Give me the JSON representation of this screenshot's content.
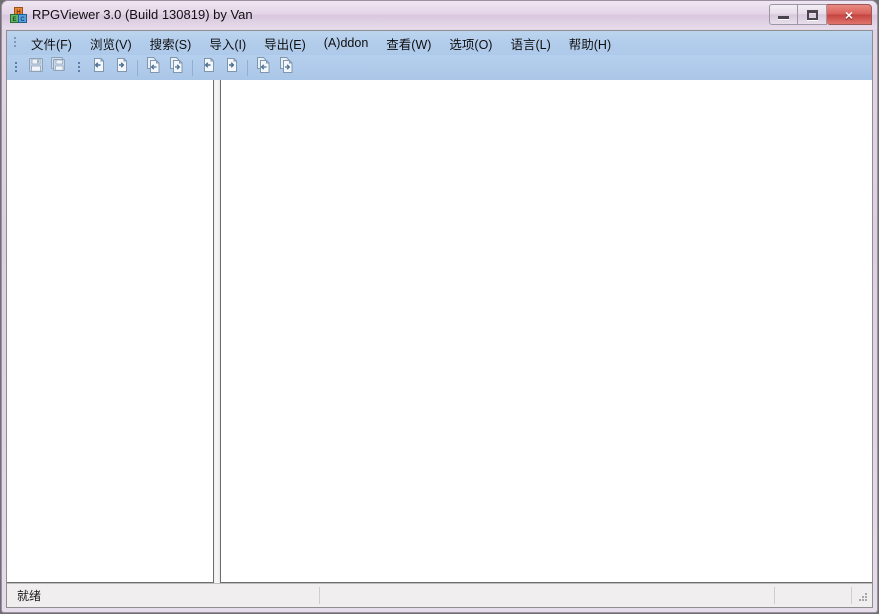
{
  "window": {
    "title": "RPGViewer 3.0 (Build 130819) by Van",
    "app_icon": "blocks-icon",
    "controls": {
      "minimize_label": "",
      "maximize_label": "",
      "close_label": "×"
    },
    "colors": {
      "titlebar": "#ded0e2",
      "menubar": "#b2cceb",
      "frame_border": "#9b8fa4",
      "close_button": "#c5433f",
      "pane_background": "#ffffff",
      "statusbar": "#f0eeee"
    }
  },
  "menubar": {
    "items": [
      {
        "label": "文件(F)",
        "name": "menu-file"
      },
      {
        "label": "浏览(V)",
        "name": "menu-browse"
      },
      {
        "label": "搜索(S)",
        "name": "menu-search"
      },
      {
        "label": "导入(I)",
        "name": "menu-import"
      },
      {
        "label": "导出(E)",
        "name": "menu-export"
      },
      {
        "label": "(A)ddon",
        "name": "menu-addon"
      },
      {
        "label": "查看(W)",
        "name": "menu-view"
      },
      {
        "label": "选项(O)",
        "name": "menu-options"
      },
      {
        "label": "语言(L)",
        "name": "menu-language"
      },
      {
        "label": "帮助(H)",
        "name": "menu-help"
      }
    ]
  },
  "toolbar": {
    "groups": [
      {
        "name": "toolbar-group-save",
        "buttons": [
          {
            "name": "save-button",
            "icon": "save-icon",
            "enabled": false
          },
          {
            "name": "save-all-button",
            "icon": "save-all-icon",
            "enabled": false
          }
        ]
      },
      {
        "name": "toolbar-group-transfer-1",
        "buttons": [
          {
            "name": "import-one-button",
            "icon": "page-arrow-left-icon",
            "enabled": false
          },
          {
            "name": "export-one-button",
            "icon": "page-arrow-right-icon",
            "enabled": false
          },
          {
            "name": "import-all-button",
            "icon": "pages-arrow-left-icon",
            "enabled": false
          },
          {
            "name": "export-all-button",
            "icon": "pages-arrow-right-icon",
            "enabled": false
          }
        ]
      },
      {
        "name": "toolbar-group-transfer-2",
        "buttons": [
          {
            "name": "import-one-alt-button",
            "icon": "page-arrow-left-icon",
            "enabled": false
          },
          {
            "name": "export-one-alt-button",
            "icon": "page-arrow-right-icon",
            "enabled": false
          },
          {
            "name": "import-all-alt-button",
            "icon": "pages-arrow-left-icon",
            "enabled": false
          },
          {
            "name": "export-all-alt-button",
            "icon": "pages-arrow-right-icon",
            "enabled": false
          }
        ]
      }
    ]
  },
  "panes": {
    "left": {
      "name": "tree-pane",
      "content": ""
    },
    "right": {
      "name": "detail-pane",
      "content": ""
    }
  },
  "statusbar": {
    "cells": [
      {
        "name": "status-message",
        "text": "就绪"
      },
      {
        "name": "status-cell-2",
        "text": ""
      },
      {
        "name": "status-cell-3",
        "text": ""
      },
      {
        "name": "status-cell-4",
        "text": ""
      }
    ],
    "resize_grip": "resize-grip-icon"
  }
}
